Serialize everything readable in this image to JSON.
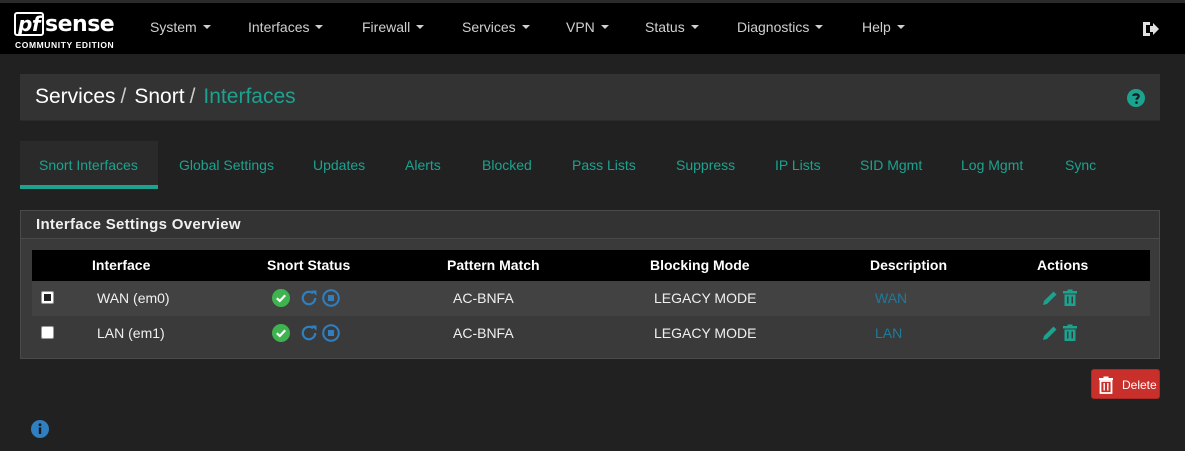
{
  "brand": {
    "name_pf": "pf",
    "name_rest": "sense",
    "edition": "COMMUNITY EDITION"
  },
  "nav": {
    "items": [
      "System",
      "Interfaces",
      "Firewall",
      "Services",
      "VPN",
      "Status",
      "Diagnostics",
      "Help"
    ]
  },
  "breadcrumb": {
    "level1": "Services",
    "level2": "Snort",
    "level3": "Interfaces",
    "separator": "/"
  },
  "tabs": [
    "Snort Interfaces",
    "Global Settings",
    "Updates",
    "Alerts",
    "Blocked",
    "Pass Lists",
    "Suppress",
    "IP Lists",
    "SID Mgmt",
    "Log Mgmt",
    "Sync"
  ],
  "panel": {
    "title": "Interface Settings Overview",
    "columns": [
      "Interface",
      "Snort Status",
      "Pattern Match",
      "Blocking Mode",
      "Description",
      "Actions"
    ],
    "rows": [
      {
        "interface": "WAN (em0)",
        "pattern": "AC-BNFA",
        "blocking": "LEGACY MODE",
        "description": "WAN",
        "checked": true
      },
      {
        "interface": "LAN (em1)",
        "pattern": "AC-BNFA",
        "blocking": "LEGACY MODE",
        "description": "LAN",
        "checked": false
      }
    ]
  },
  "actions": {
    "delete_label": "Delete"
  },
  "colors": {
    "accent": "#1ba390",
    "danger": "#c9302c",
    "ok": "#3fb34f",
    "link": "#1f7a9c",
    "info": "#2f7fc1"
  },
  "icons": [
    "logout-icon",
    "help-icon",
    "status-ok-icon",
    "restart-icon",
    "stop-icon",
    "edit-icon",
    "trash-icon",
    "info-icon"
  ]
}
